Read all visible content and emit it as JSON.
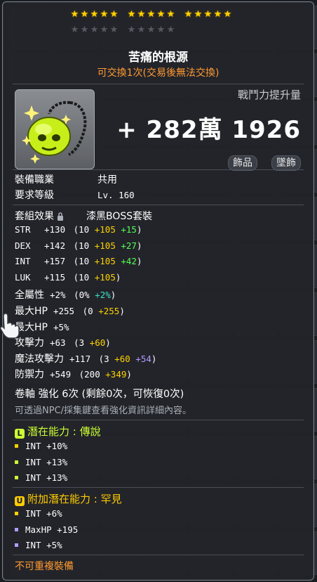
{
  "item": {
    "name": "苦痛的根源",
    "tradeable": "可交換1次(交易後無法交換)",
    "stars": {
      "filled": 15,
      "total": 25
    }
  },
  "combat_power": {
    "label": "戰鬥力提升量",
    "value": "+ 282萬 1926"
  },
  "tags": [
    "飾品",
    "墜飾"
  ],
  "requirements": [
    {
      "label": "裝備職業",
      "value": "共用"
    },
    {
      "label": "要求等級",
      "value": "Lv. 160"
    }
  ],
  "set": {
    "label": "套組效果",
    "value": "漆黑BOSS套裝"
  },
  "stats": [
    {
      "name": "STR",
      "total": "+130",
      "base": "(10",
      "scroll": "+105",
      "extra": "+15",
      "extra_color": "green",
      "close": ")"
    },
    {
      "name": "DEX",
      "total": "+142",
      "base": "(10",
      "scroll": "+105",
      "extra": "+27",
      "extra_color": "green",
      "close": ")"
    },
    {
      "name": "INT",
      "total": "+157",
      "base": "(10",
      "scroll": "+105",
      "extra": "+42",
      "extra_color": "green",
      "close": ")"
    },
    {
      "name": "LUK",
      "total": "+115",
      "base": "(10",
      "scroll": "+105",
      "extra": "",
      "extra_color": "green",
      "close": ")"
    },
    {
      "name": "全屬性",
      "total": "+2%",
      "base": "(0%",
      "scroll": "",
      "extra": "+2%",
      "extra_color": "cyan",
      "close": ")"
    },
    {
      "name": "最大HP",
      "total": "+255",
      "base": "(0",
      "scroll": "+255",
      "extra": "",
      "extra_color": "green",
      "close": ")"
    },
    {
      "name": "最大HP",
      "total": "+5%",
      "base": "",
      "scroll": "",
      "extra": "",
      "extra_color": "green",
      "close": ""
    },
    {
      "name": "攻擊力",
      "total": "+63",
      "base": "(3",
      "scroll": "+60",
      "extra": "",
      "extra_color": "green",
      "close": ")"
    },
    {
      "name": "魔法攻擊力",
      "total": "+117",
      "base": "(3",
      "scroll": "+60",
      "extra": "+54",
      "extra_color": "purple",
      "close": ")"
    },
    {
      "name": "防禦力",
      "total": "+549",
      "base": "(200",
      "scroll": "+349",
      "extra": "",
      "extra_color": "green",
      "close": ")"
    }
  ],
  "enhance": {
    "line": "卷軸 強化 6次 (剩餘0次，可恢復0次)",
    "note": "可透過NPC/採集鍵查看強化資訊詳細內容。"
  },
  "potential": {
    "icon": "L",
    "title": "潛在能力 : 傳說",
    "color": "#ccff33",
    "lines": [
      "INT +10%",
      "INT +13%",
      "INT +13%"
    ],
    "bullet_colors": [
      "#ffd200",
      "#ccff33",
      "#ccff33"
    ]
  },
  "bonus_potential": {
    "icon": "U",
    "title": "附加潛在能力 : 罕見",
    "color": "#ffcc00",
    "lines": [
      "INT +6%",
      "MaxHP +195",
      "INT +5%"
    ],
    "bullet_colors": [
      "#ffd200",
      "#b49cff",
      "#b49cff"
    ]
  },
  "footer": "不可重複裝備"
}
